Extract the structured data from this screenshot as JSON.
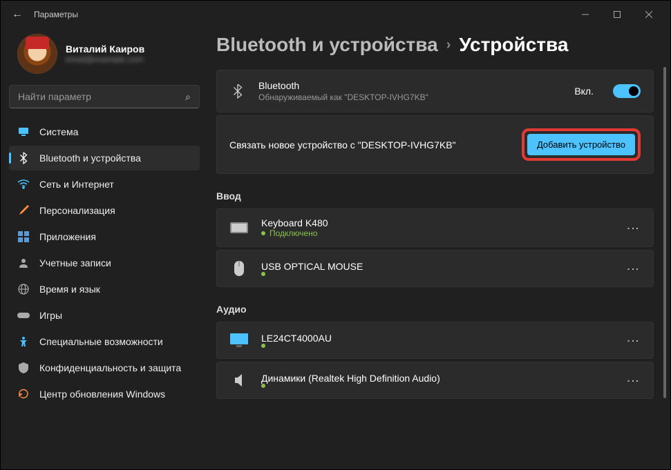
{
  "titlebar": {
    "app_title": "Параметры"
  },
  "profile": {
    "name": "Виталий Каиров",
    "email": "email@example.com"
  },
  "search": {
    "placeholder": "Найти параметр"
  },
  "nav": [
    {
      "id": "system",
      "label": "Система",
      "icon": "monitor",
      "color": "#4cc2ff"
    },
    {
      "id": "bluetooth",
      "label": "Bluetooth и устройства",
      "icon": "bluetooth",
      "color": "#4cc2ff",
      "active": true
    },
    {
      "id": "network",
      "label": "Сеть и Интернет",
      "icon": "wifi",
      "color": "#4cc2ff"
    },
    {
      "id": "personalization",
      "label": "Персонализация",
      "icon": "brush",
      "color": "#ff8c42"
    },
    {
      "id": "apps",
      "label": "Приложения",
      "icon": "grid",
      "color": "#5b9bd5"
    },
    {
      "id": "accounts",
      "label": "Учетные записи",
      "icon": "user",
      "color": "#888"
    },
    {
      "id": "time",
      "label": "Время и язык",
      "icon": "globe",
      "color": "#888"
    },
    {
      "id": "gaming",
      "label": "Игры",
      "icon": "gamepad",
      "color": "#888"
    },
    {
      "id": "accessibility",
      "label": "Специальные возможности",
      "icon": "accessibility",
      "color": "#4cc2ff"
    },
    {
      "id": "privacy",
      "label": "Конфиденциальность и защита",
      "icon": "shield",
      "color": "#888"
    },
    {
      "id": "update",
      "label": "Центр обновления Windows",
      "icon": "update",
      "color": "#ff8c42"
    }
  ],
  "breadcrumb": {
    "parent": "Bluetooth и устройства",
    "current": "Устройства"
  },
  "bluetooth_card": {
    "title": "Bluetooth",
    "subtitle": "Обнаруживаемый как \"DESKTOP-IVHG7KB\"",
    "toggle_label": "Вкл.",
    "enabled": true
  },
  "pair_card": {
    "text": "Связать новое устройство с \"DESKTOP-IVHG7KB\"",
    "button": "Добавить устройство"
  },
  "sections": {
    "input": {
      "title": "Ввод",
      "devices": [
        {
          "name": "Keyboard K480",
          "status": "Подключено",
          "icon": "keyboard"
        },
        {
          "name": "USB OPTICAL MOUSE",
          "status": "",
          "icon": "mouse"
        }
      ]
    },
    "audio": {
      "title": "Аудио",
      "devices": [
        {
          "name": "LE24CT4000AU",
          "status": "",
          "icon": "display"
        },
        {
          "name": "Динамики (Realtek High Definition Audio)",
          "status": "",
          "icon": "speaker"
        }
      ]
    }
  }
}
